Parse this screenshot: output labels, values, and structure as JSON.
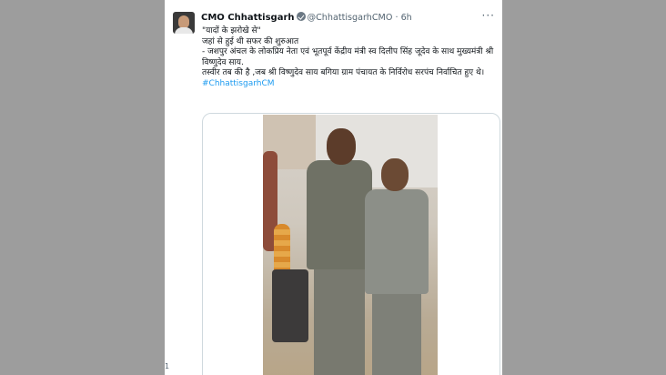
{
  "tweet": {
    "author_name": "CMO Chhattisgarh",
    "handle": "@ChhattisgarhCMO",
    "separator": "·",
    "time": "6h",
    "more_label": "···",
    "lines": [
      "\"यादों के झरोखे से\"",
      "जहां से हुई थी सफर की शुरुआत",
      "- जशपुर अंचल के लोकप्रिय नेता एवं भूतपूर्व केंद्रीय मंत्री स्व दिलीप सिंह जूदेव के साथ मुख्यमंत्री श्री विष्णुदेव साय.",
      "तस्वीर तब की है ,जब श्री विष्णुदेव साय बगिया ग्राम पंचायत के निर्विरोध सरपंच निर्वाचित हुए थे।"
    ],
    "hashtag": "#ChhattisgarhCM"
  },
  "corner_text": "1"
}
